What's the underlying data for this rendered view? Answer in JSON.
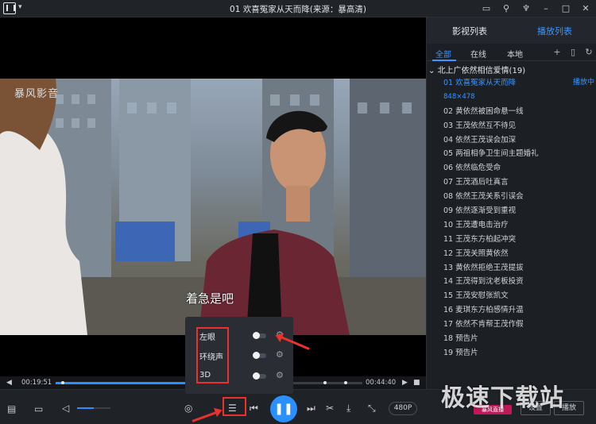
{
  "window": {
    "title": "01 欢喜冤家从天而降(来源：暴高清)",
    "title_icons": [
      "feedback-icon",
      "pin-icon",
      "skin-icon",
      "minimize-icon",
      "maximize-icon",
      "close-icon"
    ]
  },
  "video": {
    "watermark_logo": "暴风影音",
    "subtitle": "着急是吧"
  },
  "progress": {
    "current_time": "00:19:51",
    "total_time": "00:44:40",
    "played_fraction": 0.444
  },
  "audio_popup": {
    "options": [
      {
        "label": "左眼",
        "enabled": false
      },
      {
        "label": "环绕声",
        "enabled": false
      },
      {
        "label": "3D",
        "enabled": false
      }
    ]
  },
  "controls": {
    "volume_fraction": 0.5,
    "resolution": "480P",
    "icons": [
      "toolbox-icon",
      "folder-icon",
      "volume-icon",
      "3d-glasses-icon",
      "equalizer-icon",
      "prev-icon",
      "pause-icon",
      "next-icon",
      "cut-icon",
      "download-icon",
      "fullscreen-icon"
    ]
  },
  "sidebar": {
    "tabs": [
      "影视列表",
      "播放列表"
    ],
    "active_tab": "播放列表",
    "sub_tabs": [
      "全部",
      "在线",
      "本地"
    ],
    "active_sub_tab": "全部",
    "group_title": "北上广依然相信爱情(19)",
    "now_playing_tag": "播放中",
    "items": [
      "01 欢喜冤家从天而降",
      "848×478",
      "02 黄依然被困命悬一线",
      "03 王茂依然互不待见",
      "04 依然王茂误会加深",
      "05 两祖相争卫生间主题婚礼",
      "06 依然临危受命",
      "07 王茂酒后吐真言",
      "08 依然王茂关系引误会",
      "09 依然逐渐受到重视",
      "10 王茂遭电击治疗",
      "11 王茂东方柏起冲突",
      "12 王茂关照黄依然",
      "13 黄依然拒绝王茂提拔",
      "14 王茂得到沈老板投资",
      "15 王茂安慰张凯文",
      "16 麦琪东方柏感情升温",
      "17 依然不肯帮王茂作假",
      "18 预告片",
      "19 预告片"
    ]
  },
  "site_watermark": {
    "text": "极速下载站",
    "chip": "暴风直播",
    "buttons": [
      "设置",
      "播放"
    ]
  },
  "colors": {
    "accent": "#2a8fff",
    "annotation_red": "#e8322e"
  }
}
